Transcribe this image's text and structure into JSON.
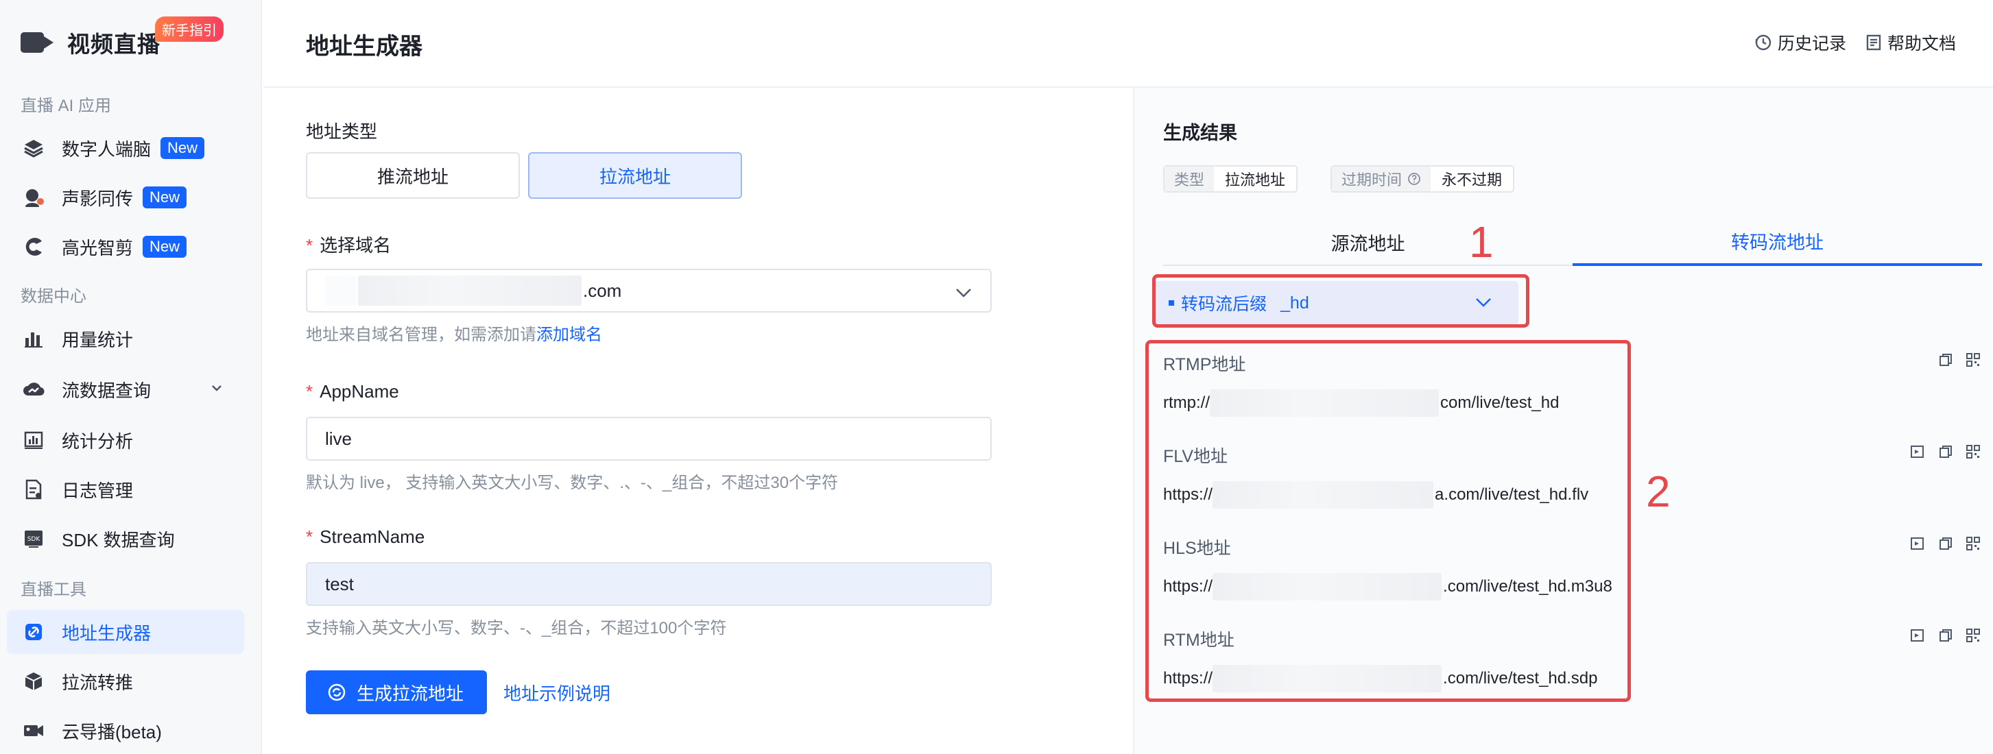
{
  "sidebar": {
    "brand_title": "视频直播",
    "brand_badge": "新手指引",
    "sections": [
      "直播 AI 应用",
      "数据中心",
      "直播工具"
    ],
    "items": [
      {
        "label": "数字人端脑",
        "badge": "New",
        "icon": "layers-icon"
      },
      {
        "label": "声影同传",
        "badge": "New",
        "icon": "voice-avatar-icon"
      },
      {
        "label": "高光智剪",
        "badge": "New",
        "icon": "highlight-clip-icon"
      },
      {
        "label": "用量统计",
        "icon": "usage-chart-icon"
      },
      {
        "label": "流数据查询",
        "icon": "cloud-data-icon"
      },
      {
        "label": "统计分析",
        "icon": "analysis-chart-icon"
      },
      {
        "label": "日志管理",
        "icon": "log-file-icon"
      },
      {
        "label": "SDK 数据查询",
        "icon": "sdk-icon"
      },
      {
        "label": "地址生成器",
        "icon": "link-icon",
        "active": true
      },
      {
        "label": "拉流转推",
        "icon": "relay-box-icon"
      },
      {
        "label": "云导播(beta)",
        "icon": "director-camera-icon"
      }
    ]
  },
  "header": {
    "title": "地址生成器",
    "history_label": "历史记录",
    "help_label": "帮助文档"
  },
  "form": {
    "address_type_label": "地址类型",
    "push_label": "推流地址",
    "pull_label": "拉流地址",
    "domain_label": "选择域名",
    "domain_suffix": ".com",
    "domain_hint": "地址来自域名管理，如需添加请",
    "domain_hint_link": "添加域名",
    "appname_label": "AppName",
    "appname_value": "live",
    "appname_hint": "默认为 live， 支持输入英文大小写、数字、.、-、_组合，不超过30个字符",
    "streamname_label": "StreamName",
    "streamname_value": "test",
    "streamname_hint": "支持输入英文大小写、数字、-、_组合，不超过100个字符",
    "generate_button": "生成拉流地址",
    "example_link": "地址示例说明"
  },
  "result": {
    "title": "生成结果",
    "type_key": "类型",
    "type_value": "拉流地址",
    "expire_key": "过期时间",
    "expire_value": "永不过期",
    "tabs": [
      "源流地址",
      "转码流地址"
    ],
    "suffix_label": "转码流后缀",
    "suffix_value": "_hd",
    "urls": [
      {
        "label": "RTMP地址",
        "prefix": "rtmp://",
        "suffix": "com/live/test_hd"
      },
      {
        "label": "FLV地址",
        "prefix": "https://",
        "suffix": "a.com/live/test_hd.flv"
      },
      {
        "label": "HLS地址",
        "prefix": "https://",
        "suffix": ".com/live/test_hd.m3u8"
      },
      {
        "label": "RTM地址",
        "prefix": "https://",
        "suffix": ".com/live/test_hd.sdp"
      }
    ]
  },
  "annotations": {
    "one": "1",
    "two": "2"
  },
  "colors": {
    "accent": "#1664ff",
    "annotation": "#e5484d"
  }
}
